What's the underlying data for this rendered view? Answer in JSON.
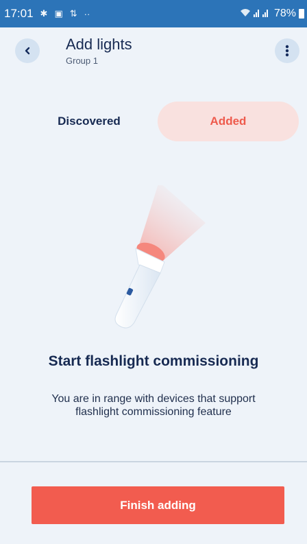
{
  "status_bar": {
    "time": "17:01",
    "battery": "78%"
  },
  "header": {
    "title": "Add lights",
    "subtitle": "Group 1",
    "back_icon": "back-chevron-icon",
    "more_icon": "more-vertical-icon"
  },
  "tabs": [
    {
      "label": "Discovered",
      "selected": false
    },
    {
      "label": "Added",
      "selected": true
    }
  ],
  "main": {
    "illustration": "flashlight-icon",
    "heading": "Start flashlight commissioning",
    "description": "You are in range with devices that support flashlight commissioning feature"
  },
  "footer": {
    "finish_label": "Finish adding"
  },
  "colors": {
    "status_bar": "#2c74b8",
    "background": "#eef3f9",
    "accent": "#f25c4f",
    "primary_text": "#172a52"
  }
}
